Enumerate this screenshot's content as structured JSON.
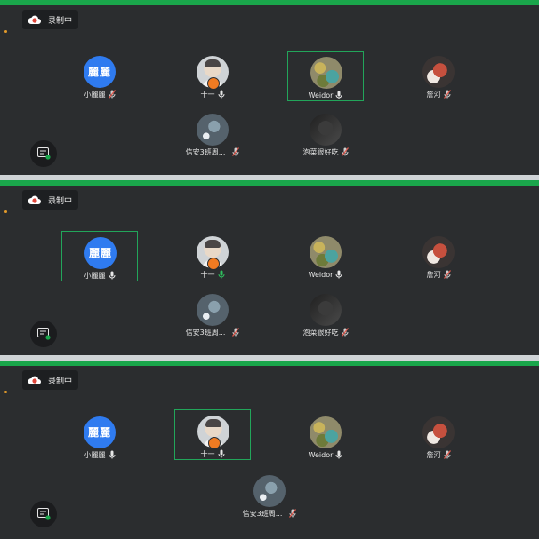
{
  "frames": [
    {
      "recording_label": "录制中",
      "participants": [
        {
          "name": "小麗麗",
          "avatar_text": "麗麗",
          "avatar": "blue",
          "mic": "muted-mic-icon",
          "active": false
        },
        {
          "name": "十一",
          "avatar_text": "",
          "avatar": "man",
          "mic": "mic-icon",
          "active": false,
          "badge": true
        },
        {
          "name": "Weidor",
          "avatar_text": "",
          "avatar": "art",
          "mic": "mic-icon",
          "active": true
        },
        {
          "name": "詹河",
          "avatar_text": "",
          "avatar": "panda",
          "mic": "muted-mic-icon",
          "active": false
        },
        {
          "name": "信安3班周...",
          "avatar_text": "",
          "avatar": "stars",
          "mic": "muted-mic-icon",
          "active": false
        },
        {
          "name": "泡菜很好吃",
          "avatar_text": "",
          "avatar": "dark",
          "mic": "muted-mic-icon",
          "active": false
        }
      ]
    },
    {
      "recording_label": "录制中",
      "participants": [
        {
          "name": "小麗麗",
          "avatar_text": "麗麗",
          "avatar": "blue",
          "mic": "mic-icon",
          "active": true
        },
        {
          "name": "十一",
          "avatar_text": "",
          "avatar": "man",
          "mic": "mic-speaking-icon",
          "active": false,
          "badge": true
        },
        {
          "name": "Weidor",
          "avatar_text": "",
          "avatar": "art",
          "mic": "mic-icon",
          "active": false
        },
        {
          "name": "詹河",
          "avatar_text": "",
          "avatar": "panda",
          "mic": "muted-mic-icon",
          "active": false
        },
        {
          "name": "信安3班周...",
          "avatar_text": "",
          "avatar": "stars",
          "mic": "muted-mic-icon",
          "active": false
        },
        {
          "name": "泡菜很好吃",
          "avatar_text": "",
          "avatar": "dark",
          "mic": "muted-mic-icon",
          "active": false
        }
      ]
    },
    {
      "recording_label": "录制中",
      "participants": [
        {
          "name": "小麗麗",
          "avatar_text": "麗麗",
          "avatar": "blue",
          "mic": "mic-icon",
          "active": false
        },
        {
          "name": "十一",
          "avatar_text": "",
          "avatar": "man",
          "mic": "mic-icon",
          "active": true,
          "badge": true
        },
        {
          "name": "Weidor",
          "avatar_text": "",
          "avatar": "art",
          "mic": "mic-icon",
          "active": false
        },
        {
          "name": "詹河",
          "avatar_text": "",
          "avatar": "panda",
          "mic": "muted-mic-icon",
          "active": false
        },
        {
          "name": "信安3班周...",
          "avatar_text": "",
          "avatar": "stars",
          "mic": "muted-mic-icon",
          "active": false
        }
      ]
    }
  ],
  "icons": {
    "recording": "cloud-record-icon",
    "chat": "chat-bubble-icon",
    "mic": "mic-icon",
    "muted": "muted-mic-icon"
  },
  "colors": {
    "background": "#2b2d2f",
    "accent_green": "#1aa64b",
    "avatar_blue": "#2f7bf0",
    "record_red": "#e0463b",
    "muted_red": "#e05a4f",
    "badge_orange": "#f07b22"
  }
}
